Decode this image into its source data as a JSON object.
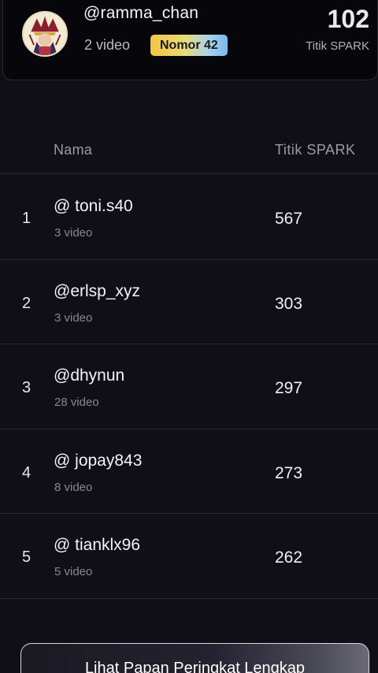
{
  "user_card": {
    "username": "@ramma_chan",
    "videos": "2 video",
    "rank_badge": "Nomor 42",
    "score": "102",
    "score_label": "Titik SPARK"
  },
  "table": {
    "header_name": "Nama",
    "header_score": "Titik SPARK",
    "rows": [
      {
        "rank": "1",
        "name": "@ toni.s40",
        "videos": "3 video",
        "score": "567"
      },
      {
        "rank": "2",
        "name": "@erlsp_xyz",
        "videos": "3 video",
        "score": "303"
      },
      {
        "rank": "3",
        "name": "@dhynun",
        "videos": "28 video",
        "score": "297"
      },
      {
        "rank": "4",
        "name": "@ jopay843",
        "videos": "8 video",
        "score": "273"
      },
      {
        "rank": "5",
        "name": "@ tianklx96",
        "videos": "5 video",
        "score": "262"
      }
    ]
  },
  "footer": {
    "full_leaderboard_label": "Lihat Papan Peringkat Lengkap"
  }
}
